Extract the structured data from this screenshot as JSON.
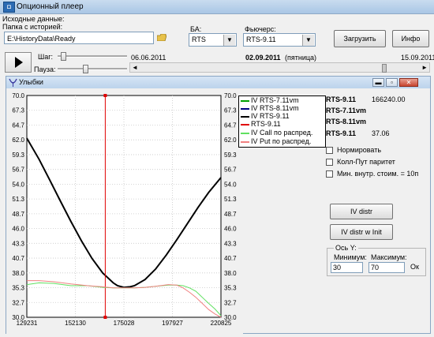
{
  "window": {
    "title": "Опционный плеер",
    "icon": "app-icon"
  },
  "source": {
    "heading": "Исходные данные:",
    "folder_label": "Папка с историей:",
    "folder_value": "E:\\HistoryData\\Ready",
    "ba_label": "БА:",
    "ba_value": "RTS",
    "futures_label": "Фьючерс:",
    "futures_value": "RTS-9.11",
    "load_button": "Загрузить",
    "info_button": "Инфо"
  },
  "player": {
    "step_label": "Шаг:",
    "pause_label": "Пауза:",
    "date_start": "06.06.2011",
    "date_current": "02.09.2011",
    "weekday": "(пятница)",
    "date_end": "15.09.2011",
    "timeline_position": 0.88
  },
  "smiles": {
    "title": "Улыбки",
    "info": [
      {
        "name": "RTS-9.11",
        "value": "166240.00"
      },
      {
        "name": "RTS-7.11vm",
        "value": ""
      },
      {
        "name": "RTS-8.11vm",
        "value": ""
      },
      {
        "name": "RTS-9.11",
        "value": "37.06"
      }
    ],
    "checkboxes": [
      {
        "label": "Нормировать",
        "checked": false
      },
      {
        "label": "Колл-Пут паритет",
        "checked": false
      },
      {
        "label": "Мин. внутр. стоим. = 10п",
        "checked": false
      }
    ],
    "iv_distr_button": "IV distr",
    "iv_distr_init_button": "IV distr w Init",
    "axis_group": {
      "title": "Ось Y:",
      "min_label": "Минимум:",
      "min_value": "30",
      "max_label": "Максимум:",
      "max_value": "70",
      "ok_button": "Ок"
    }
  },
  "chart_data": {
    "type": "line",
    "title": "",
    "xlabel": "",
    "ylabel": "",
    "x_ticks": [
      "129231",
      "152130",
      "175028",
      "197927",
      "220825"
    ],
    "y_ticks": [
      "70.0",
      "67.3",
      "64.7",
      "62.0",
      "59.3",
      "56.7",
      "54.0",
      "51.3",
      "48.7",
      "46.0",
      "43.3",
      "40.7",
      "38.0",
      "35.3",
      "32.7",
      "30.0"
    ],
    "xlim": [
      129231,
      220825
    ],
    "ylim": [
      30,
      70
    ],
    "grid": true,
    "legend_position": "right",
    "series": [
      {
        "name": "IV RTS-7.11vm",
        "color": "#00a000",
        "x": [],
        "y": []
      },
      {
        "name": "IV RTS-8.11vm",
        "color": "#000080",
        "x": [],
        "y": []
      },
      {
        "name": "IV RTS-9.11",
        "color": "#000000",
        "x": [
          129231,
          135000,
          140000,
          145000,
          150000,
          155000,
          160000,
          165000,
          170000,
          172000,
          175000,
          178000,
          180000,
          185000,
          190000,
          195000,
          200000,
          205000,
          210000,
          215000,
          220825
        ],
        "y": [
          62.3,
          58.5,
          54.8,
          51.0,
          47.3,
          43.8,
          40.6,
          38.0,
          36.2,
          35.7,
          35.4,
          35.5,
          35.7,
          36.8,
          38.7,
          41.2,
          44.0,
          46.9,
          49.8,
          52.5,
          55.2
        ]
      },
      {
        "name": "RTS-9.11",
        "color": "#e00000",
        "x": [
          166240,
          166240
        ],
        "y": [
          30,
          70
        ]
      },
      {
        "name": "IV Call по распред.",
        "color": "#60e060",
        "x": [
          129231,
          135000,
          142000,
          150000,
          158000,
          165000,
          170000,
          175000,
          180000,
          185000,
          190000,
          196000,
          200000,
          203000,
          206000,
          209000,
          212000,
          215000,
          218000,
          220825
        ],
        "y": [
          35.9,
          36.2,
          36.1,
          35.7,
          35.7,
          35.4,
          35.3,
          35.3,
          35.3,
          35.4,
          35.6,
          35.8,
          35.8,
          35.7,
          35.3,
          34.7,
          33.6,
          32.5,
          31.5,
          30.3
        ]
      },
      {
        "name": "IV Put по распред.",
        "color": "#f08080",
        "x": [
          129231,
          135000,
          142000,
          150000,
          158000,
          165000,
          170000,
          175000,
          180000,
          185000,
          190000,
          196000,
          200000,
          203000,
          206000,
          209000,
          212000,
          215000,
          218000,
          220825
        ],
        "y": [
          36.6,
          36.6,
          36.4,
          36.0,
          35.7,
          35.5,
          35.3,
          35.3,
          35.3,
          35.4,
          35.6,
          35.9,
          35.8,
          35.3,
          34.5,
          33.6,
          32.5,
          31.4,
          30.6,
          30.0
        ]
      }
    ]
  }
}
